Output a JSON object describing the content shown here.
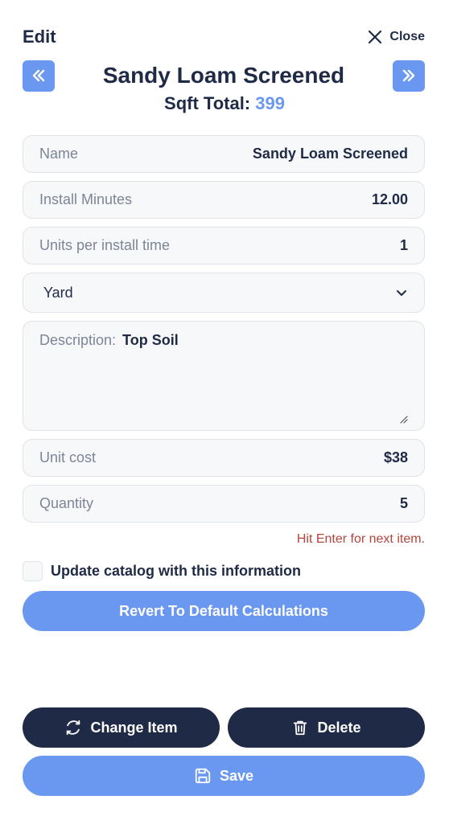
{
  "header": {
    "title": "Edit",
    "close_label": "Close"
  },
  "item": {
    "title": "Sandy Loam Screened",
    "sqft_label": "Sqft Total:",
    "sqft_value": "399"
  },
  "fields": {
    "name": {
      "label": "Name",
      "value": "Sandy Loam Screened"
    },
    "install_minutes": {
      "label": "Install Minutes",
      "value": "12.00"
    },
    "units_per_install": {
      "label": "Units per install time",
      "value": "1"
    },
    "unit_select": {
      "value": "Yard"
    },
    "description": {
      "label": "Description:",
      "value": "Top Soil"
    },
    "unit_cost": {
      "label": "Unit cost",
      "value": "$38"
    },
    "quantity": {
      "label": "Quantity",
      "value": "5"
    }
  },
  "hint": "Hit Enter for next item.",
  "catalog_checkbox": {
    "label": "Update catalog with this information",
    "checked": false
  },
  "buttons": {
    "revert": "Revert To Default Calculations",
    "change_item": "Change Item",
    "delete": "Delete",
    "save": "Save"
  },
  "icons": {
    "close": "close-icon",
    "prev": "double-chevron-left-icon",
    "next": "double-chevron-right-icon",
    "dropdown": "chevron-down-icon",
    "change": "refresh-icon",
    "delete": "trash-icon",
    "save": "floppy-disk-icon"
  },
  "colors": {
    "primary_dark": "#1e2a46",
    "accent_blue": "#6a98f0",
    "hint_red": "#b5453a",
    "field_bg": "#f7f8fa",
    "field_border": "#dfe3ea"
  }
}
